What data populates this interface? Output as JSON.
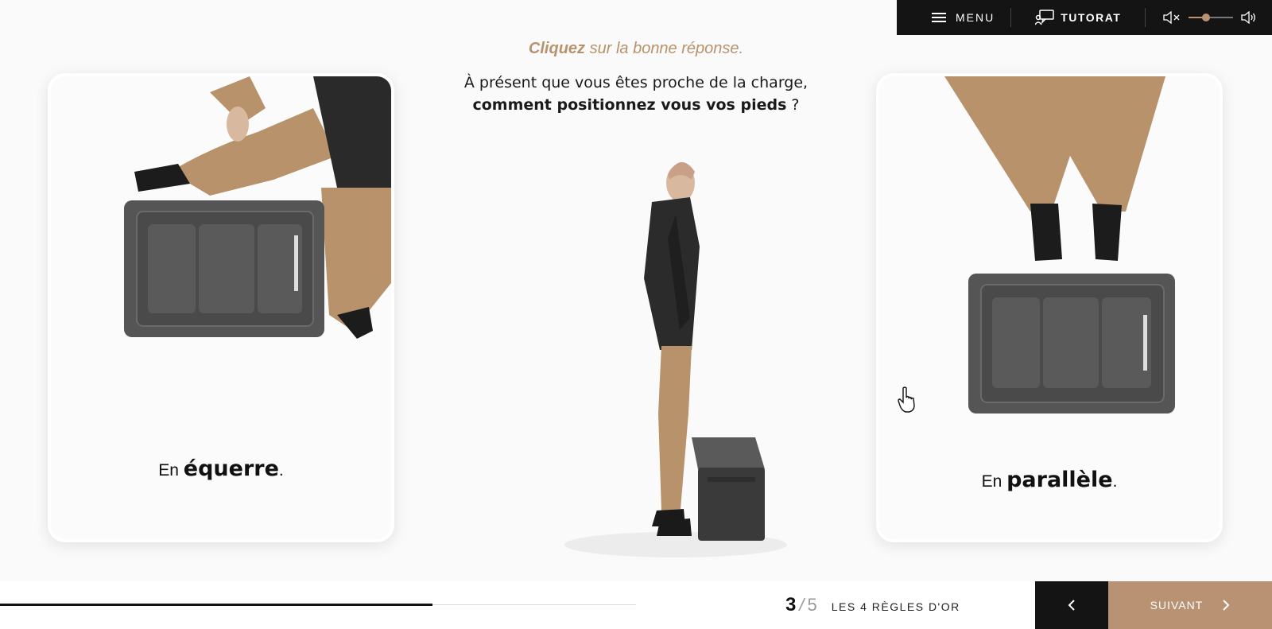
{
  "topbar": {
    "menu_label": "MENU",
    "tutorat_label": "TUTORAT",
    "volume_level": 0.38
  },
  "instruction": {
    "prompt_bold": "Cliquez",
    "prompt_rest": " sur la bonne réponse.",
    "question_line1": "À présent que vous êtes proche de la charge,",
    "question_bold": "comment positionnez vous vos pieds",
    "question_end": " ?"
  },
  "options": [
    {
      "prefix": "En ",
      "bold": "équerre",
      "suffix": "."
    },
    {
      "prefix": "En ",
      "bold": "parallèle",
      "suffix": "."
    }
  ],
  "footer": {
    "progress": 0.68,
    "current": "3",
    "slash": "/",
    "total": "5",
    "chapter": "LES 4 RÈGLES D'OR",
    "next_label": "SUIVANT"
  },
  "colors": {
    "accent": "#b89272",
    "dark": "#141414"
  }
}
